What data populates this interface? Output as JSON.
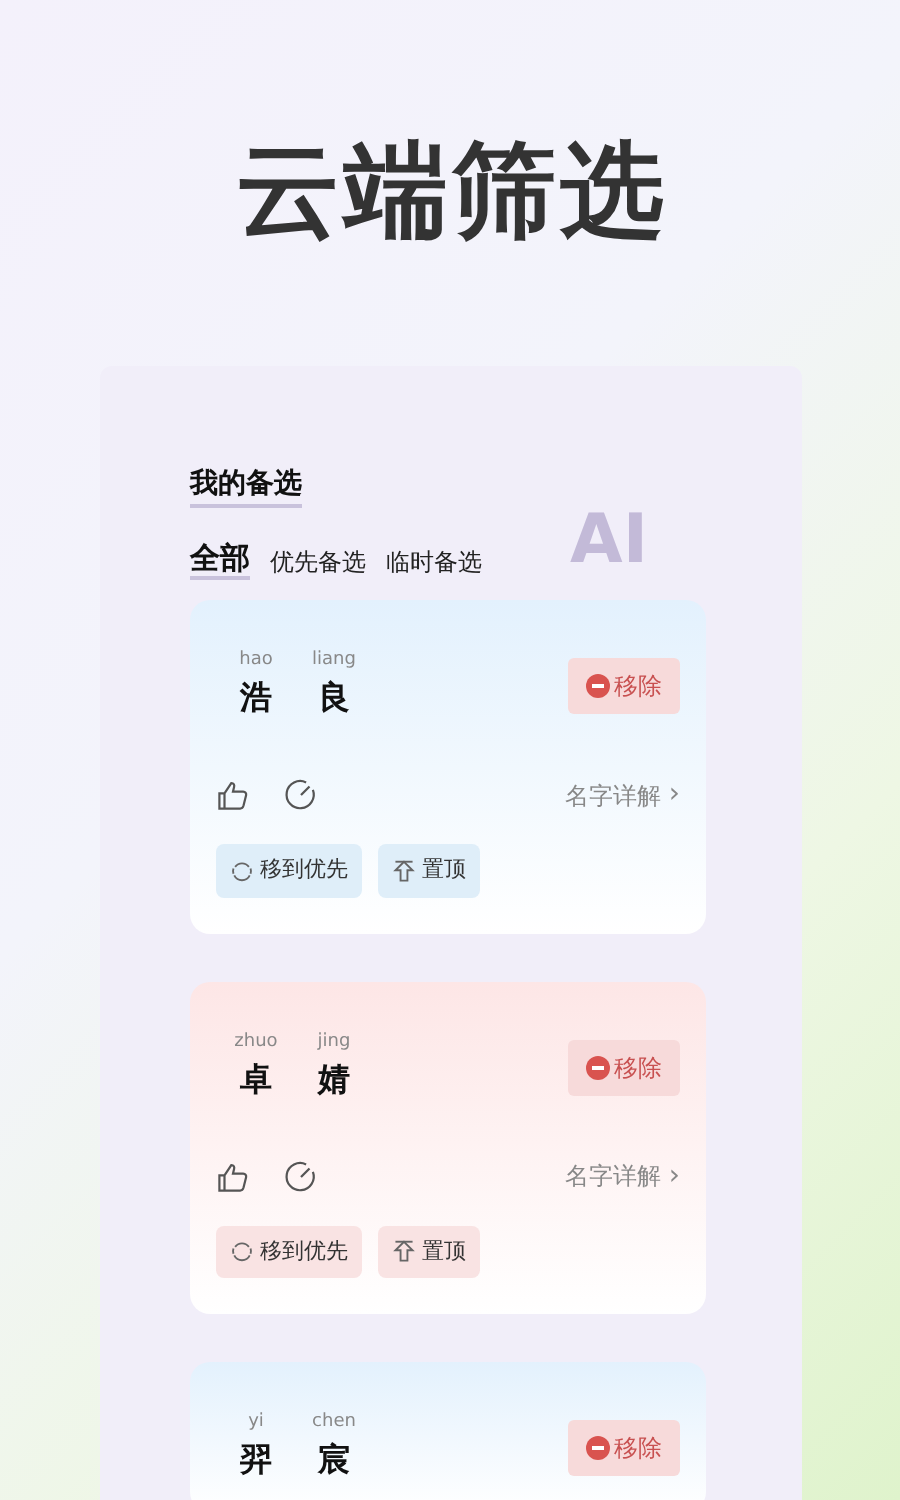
{
  "headline": "云端筛选",
  "panel": {
    "title": "我的备选",
    "badge": "AI",
    "tabs": [
      {
        "label": "全部",
        "selected": true
      },
      {
        "label": "优先备选",
        "selected": false
      },
      {
        "label": "临时备选",
        "selected": false
      }
    ],
    "cards": [
      {
        "color": "#e3f1fd",
        "chars": [
          {
            "pinyin": "hao",
            "hanzi": "浩"
          },
          {
            "pinyin": "liang",
            "hanzi": "良"
          }
        ],
        "remove": "移除",
        "detail": "名字详解",
        "detail_arrow": "›",
        "actions": [
          {
            "kind": "move",
            "label": "移到优先"
          },
          {
            "kind": "top",
            "label": "置顶"
          }
        ]
      },
      {
        "color": "#fde6e6",
        "chars": [
          {
            "pinyin": "zhuo",
            "hanzi": "卓"
          },
          {
            "pinyin": "jing",
            "hanzi": "婧"
          }
        ],
        "remove": "移除",
        "detail": "名字详解",
        "detail_arrow": "›",
        "actions": [
          {
            "kind": "move",
            "label": "移到优先"
          },
          {
            "kind": "top",
            "label": "置顶"
          }
        ]
      },
      {
        "color": "#e3f1fd",
        "chars": [
          {
            "pinyin": "yi",
            "hanzi": "羿"
          },
          {
            "pinyin": "chen",
            "hanzi": "宸"
          }
        ],
        "remove": "移除"
      }
    ]
  }
}
